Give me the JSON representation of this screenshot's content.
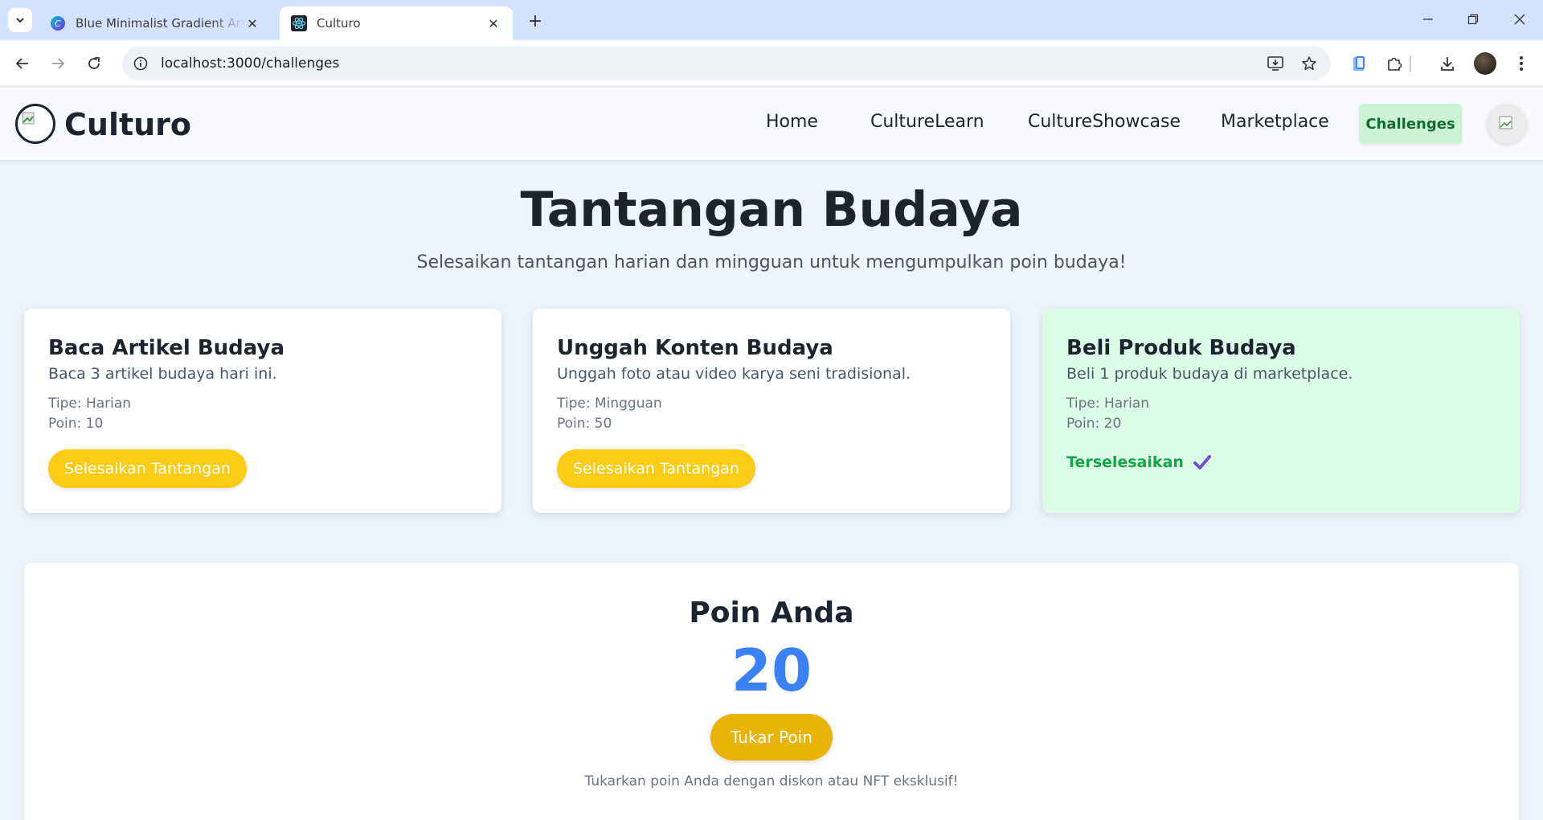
{
  "browser": {
    "tabs": [
      {
        "title": "Blue Minimalist Gradient Art and",
        "active": false,
        "icon": "canva-icon"
      },
      {
        "title": "Culturo",
        "active": true,
        "icon": "react-icon"
      }
    ],
    "url": "localhost:3000/challenges"
  },
  "app": {
    "brand": "Culturo",
    "nav": [
      {
        "label": "Home"
      },
      {
        "label": "CultureLearn"
      },
      {
        "label": "CultureShowcase"
      },
      {
        "label": "Marketplace"
      }
    ],
    "active_nav": "Challenges"
  },
  "page": {
    "title": "Tantangan Budaya",
    "subtitle": "Selesaikan tantangan harian dan mingguan untuk mengumpulkan poin budaya!"
  },
  "challenges": [
    {
      "title": "Baca Artikel Budaya",
      "description": "Baca 3 artikel budaya hari ini.",
      "type": "Tipe: Harian",
      "points": "Poin: 10",
      "action": "Selesaikan Tantangan",
      "completed": false
    },
    {
      "title": "Unggah Konten Budaya",
      "description": "Unggah foto atau video karya seni tradisional.",
      "type": "Tipe: Mingguan",
      "points": "Poin: 50",
      "action": "Selesaikan Tantangan",
      "completed": false
    },
    {
      "title": "Beli Produk Budaya",
      "description": "Beli 1 produk budaya di marketplace.",
      "type": "Tipe: Harian",
      "points": "Poin: 20",
      "status": "Terselesaikan",
      "completed": true
    }
  ],
  "points": {
    "title": "Poin Anda",
    "value": "20",
    "redeem_label": "Tukar Poin",
    "note": "Tukarkan poin Anda dengan diskon atau NFT eksklusif!"
  },
  "colors": {
    "accent_yellow": "#facc15",
    "points_blue": "#3b82f6",
    "completed_green": "#16a34a",
    "completed_bg": "#dcfce7"
  }
}
